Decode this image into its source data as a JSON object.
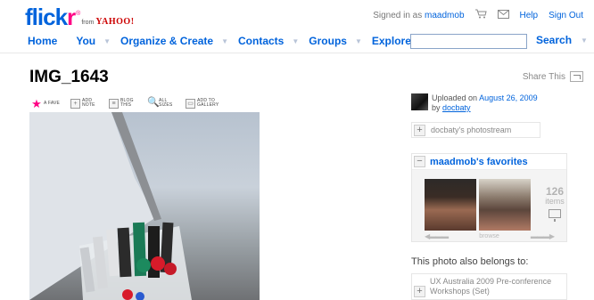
{
  "brand": {
    "flickr_fl": "flick",
    "flickr_r": "r",
    "reg": "®",
    "from": "from",
    "yahoo": "YAHOO!"
  },
  "utility": {
    "signed_in_as": "Signed in as",
    "username": "maadmob",
    "cart_icon": "cart-icon",
    "mail_icon": "mail-icon",
    "help": "Help",
    "sign_out": "Sign Out"
  },
  "nav": {
    "home": "Home",
    "you": "You",
    "organize": "Organize & Create",
    "contacts": "Contacts",
    "groups": "Groups",
    "explore": "Explore",
    "caret": "▼"
  },
  "search": {
    "value": "",
    "button": "Search"
  },
  "photo": {
    "title": "IMG_1643"
  },
  "share": {
    "label": "Share This"
  },
  "actions": [
    {
      "icon": "star-icon",
      "label": "A FAVE"
    },
    {
      "icon": "add-note-icon",
      "label": "ADD NOTE"
    },
    {
      "icon": "blog-icon",
      "label": "BLOG THIS"
    },
    {
      "icon": "magnifier-icon",
      "label": "ALL SIZES"
    },
    {
      "icon": "gallery-icon",
      "label": "ADD TO GALLERY"
    }
  ],
  "uploader": {
    "uploaded_on": "Uploaded on",
    "date": "August 26, 2009",
    "by": "by",
    "user": "docbaty"
  },
  "photostream": {
    "label": "docbaty's photostream"
  },
  "favorites": {
    "title": "maadmob's favorites",
    "count": "126",
    "count_label": "items",
    "browse": "browse",
    "left_arrow": "◀▬▬▬",
    "right_arrow": "▬▬▬▶"
  },
  "sets": {
    "belongs_label": "This photo also belongs to:",
    "set_name": "UX Australia 2009 Pre-conference Workshops (Set)"
  },
  "toggles": {
    "plus": "+",
    "minus": "−"
  }
}
